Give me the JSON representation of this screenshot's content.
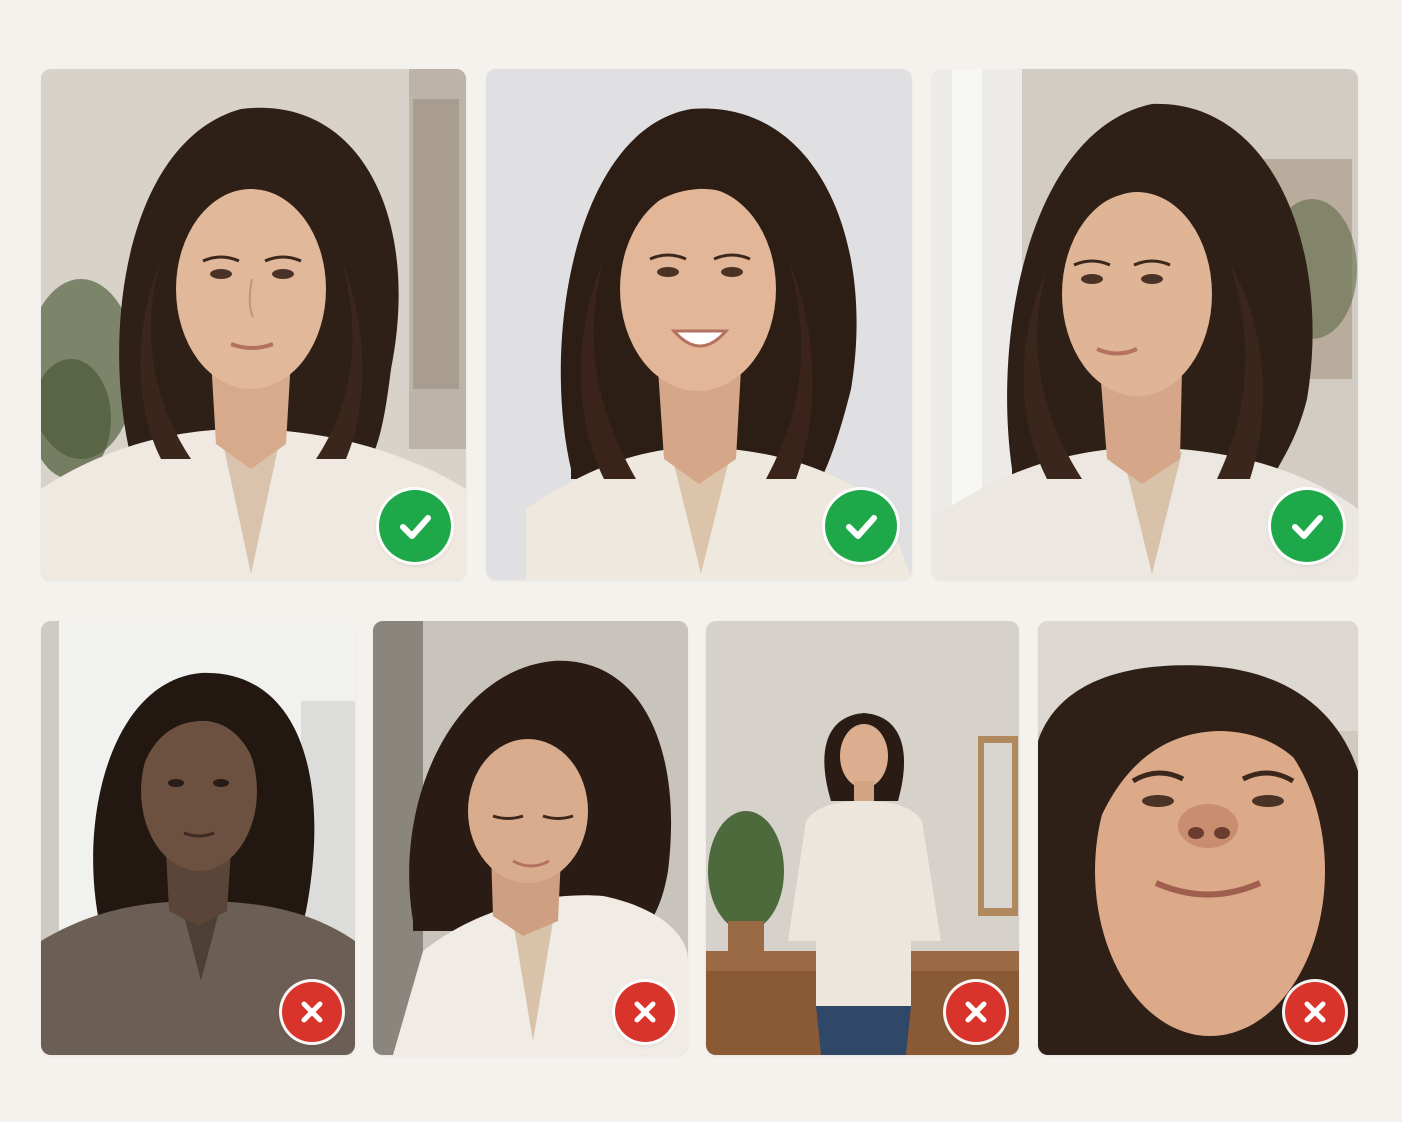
{
  "colors": {
    "background": "#f5f2ee",
    "accept": "#1fa84a",
    "reject": "#d9342b"
  },
  "good_examples": [
    {
      "id": "front-neutral",
      "status": "accepted",
      "icon": "check-icon"
    },
    {
      "id": "front-smiling",
      "status": "accepted",
      "icon": "check-icon"
    },
    {
      "id": "three-quarter-window-light",
      "status": "accepted",
      "icon": "check-icon"
    }
  ],
  "bad_examples": [
    {
      "id": "backlit",
      "status": "rejected",
      "icon": "x-icon"
    },
    {
      "id": "looking-down",
      "status": "rejected",
      "icon": "x-icon"
    },
    {
      "id": "full-body-too-far",
      "status": "rejected",
      "icon": "x-icon"
    },
    {
      "id": "low-angle-too-close",
      "status": "rejected",
      "icon": "x-icon"
    }
  ]
}
